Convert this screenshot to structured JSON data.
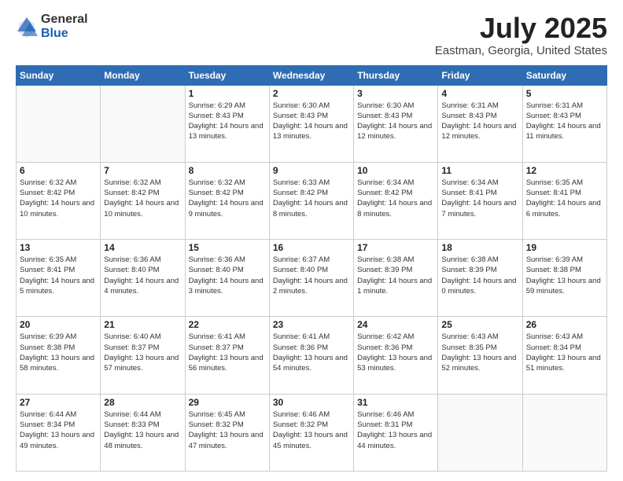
{
  "header": {
    "logo_general": "General",
    "logo_blue": "Blue",
    "month_title": "July 2025",
    "location": "Eastman, Georgia, United States"
  },
  "days_of_week": [
    "Sunday",
    "Monday",
    "Tuesday",
    "Wednesday",
    "Thursday",
    "Friday",
    "Saturday"
  ],
  "weeks": [
    [
      {
        "day": "",
        "detail": ""
      },
      {
        "day": "",
        "detail": ""
      },
      {
        "day": "1",
        "detail": "Sunrise: 6:29 AM\nSunset: 8:43 PM\nDaylight: 14 hours and 13 minutes."
      },
      {
        "day": "2",
        "detail": "Sunrise: 6:30 AM\nSunset: 8:43 PM\nDaylight: 14 hours and 13 minutes."
      },
      {
        "day": "3",
        "detail": "Sunrise: 6:30 AM\nSunset: 8:43 PM\nDaylight: 14 hours and 12 minutes."
      },
      {
        "day": "4",
        "detail": "Sunrise: 6:31 AM\nSunset: 8:43 PM\nDaylight: 14 hours and 12 minutes."
      },
      {
        "day": "5",
        "detail": "Sunrise: 6:31 AM\nSunset: 8:43 PM\nDaylight: 14 hours and 11 minutes."
      }
    ],
    [
      {
        "day": "6",
        "detail": "Sunrise: 6:32 AM\nSunset: 8:42 PM\nDaylight: 14 hours and 10 minutes."
      },
      {
        "day": "7",
        "detail": "Sunrise: 6:32 AM\nSunset: 8:42 PM\nDaylight: 14 hours and 10 minutes."
      },
      {
        "day": "8",
        "detail": "Sunrise: 6:32 AM\nSunset: 8:42 PM\nDaylight: 14 hours and 9 minutes."
      },
      {
        "day": "9",
        "detail": "Sunrise: 6:33 AM\nSunset: 8:42 PM\nDaylight: 14 hours and 8 minutes."
      },
      {
        "day": "10",
        "detail": "Sunrise: 6:34 AM\nSunset: 8:42 PM\nDaylight: 14 hours and 8 minutes."
      },
      {
        "day": "11",
        "detail": "Sunrise: 6:34 AM\nSunset: 8:41 PM\nDaylight: 14 hours and 7 minutes."
      },
      {
        "day": "12",
        "detail": "Sunrise: 6:35 AM\nSunset: 8:41 PM\nDaylight: 14 hours and 6 minutes."
      }
    ],
    [
      {
        "day": "13",
        "detail": "Sunrise: 6:35 AM\nSunset: 8:41 PM\nDaylight: 14 hours and 5 minutes."
      },
      {
        "day": "14",
        "detail": "Sunrise: 6:36 AM\nSunset: 8:40 PM\nDaylight: 14 hours and 4 minutes."
      },
      {
        "day": "15",
        "detail": "Sunrise: 6:36 AM\nSunset: 8:40 PM\nDaylight: 14 hours and 3 minutes."
      },
      {
        "day": "16",
        "detail": "Sunrise: 6:37 AM\nSunset: 8:40 PM\nDaylight: 14 hours and 2 minutes."
      },
      {
        "day": "17",
        "detail": "Sunrise: 6:38 AM\nSunset: 8:39 PM\nDaylight: 14 hours and 1 minute."
      },
      {
        "day": "18",
        "detail": "Sunrise: 6:38 AM\nSunset: 8:39 PM\nDaylight: 14 hours and 0 minutes."
      },
      {
        "day": "19",
        "detail": "Sunrise: 6:39 AM\nSunset: 8:38 PM\nDaylight: 13 hours and 59 minutes."
      }
    ],
    [
      {
        "day": "20",
        "detail": "Sunrise: 6:39 AM\nSunset: 8:38 PM\nDaylight: 13 hours and 58 minutes."
      },
      {
        "day": "21",
        "detail": "Sunrise: 6:40 AM\nSunset: 8:37 PM\nDaylight: 13 hours and 57 minutes."
      },
      {
        "day": "22",
        "detail": "Sunrise: 6:41 AM\nSunset: 8:37 PM\nDaylight: 13 hours and 56 minutes."
      },
      {
        "day": "23",
        "detail": "Sunrise: 6:41 AM\nSunset: 8:36 PM\nDaylight: 13 hours and 54 minutes."
      },
      {
        "day": "24",
        "detail": "Sunrise: 6:42 AM\nSunset: 8:36 PM\nDaylight: 13 hours and 53 minutes."
      },
      {
        "day": "25",
        "detail": "Sunrise: 6:43 AM\nSunset: 8:35 PM\nDaylight: 13 hours and 52 minutes."
      },
      {
        "day": "26",
        "detail": "Sunrise: 6:43 AM\nSunset: 8:34 PM\nDaylight: 13 hours and 51 minutes."
      }
    ],
    [
      {
        "day": "27",
        "detail": "Sunrise: 6:44 AM\nSunset: 8:34 PM\nDaylight: 13 hours and 49 minutes."
      },
      {
        "day": "28",
        "detail": "Sunrise: 6:44 AM\nSunset: 8:33 PM\nDaylight: 13 hours and 48 minutes."
      },
      {
        "day": "29",
        "detail": "Sunrise: 6:45 AM\nSunset: 8:32 PM\nDaylight: 13 hours and 47 minutes."
      },
      {
        "day": "30",
        "detail": "Sunrise: 6:46 AM\nSunset: 8:32 PM\nDaylight: 13 hours and 45 minutes."
      },
      {
        "day": "31",
        "detail": "Sunrise: 6:46 AM\nSunset: 8:31 PM\nDaylight: 13 hours and 44 minutes."
      },
      {
        "day": "",
        "detail": ""
      },
      {
        "day": "",
        "detail": ""
      }
    ]
  ]
}
